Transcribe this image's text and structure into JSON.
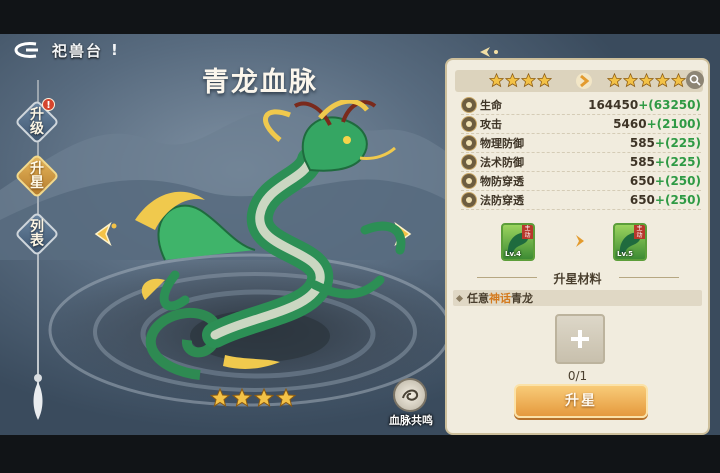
{
  "header": {
    "title": "祀兽台",
    "exclaim": "!",
    "back_icon": "back-arrow-icon"
  },
  "nav": {
    "items": [
      {
        "label": [
          "升",
          "级"
        ],
        "active": false,
        "notification": "!"
      },
      {
        "label": [
          "升",
          "星"
        ],
        "active": true
      },
      {
        "label": [
          "列",
          "表"
        ],
        "active": false
      }
    ]
  },
  "beast": {
    "name": "青龙血脉",
    "stars": 4
  },
  "resonance": {
    "label": "血脉共鸣"
  },
  "panel": {
    "current_stars": 4,
    "next_stars": 5,
    "stats": [
      {
        "icon": "heart-icon",
        "name": "生命",
        "base": "164450",
        "bonus": "+(63250)"
      },
      {
        "icon": "sword-icon",
        "name": "攻击",
        "base": "5460",
        "bonus": "+(2100)"
      },
      {
        "icon": "shield-icon",
        "name": "物理防御",
        "base": "585",
        "bonus": "+(225)"
      },
      {
        "icon": "magic-shield-icon",
        "name": "法术防御",
        "base": "585",
        "bonus": "+(225)"
      },
      {
        "icon": "claw-icon",
        "name": "物防穿透",
        "base": "650",
        "bonus": "+(250)"
      },
      {
        "icon": "spiral-icon",
        "name": "法防穿透",
        "base": "650",
        "bonus": "+(250)"
      }
    ],
    "current_card": {
      "badge": "主动",
      "level": "Lv.4"
    },
    "next_card": {
      "badge": "主动",
      "level": "Lv.5"
    },
    "materials_title": "升星材料",
    "material": {
      "prefix": "任意",
      "highlight": "神话",
      "suffix": "青龙"
    },
    "material_count": "0/1",
    "upgrade_label": "升星"
  },
  "colors": {
    "bonus_green": "#2f9a45",
    "gold": "#f3c247",
    "myth_orange": "#d47a1e"
  }
}
